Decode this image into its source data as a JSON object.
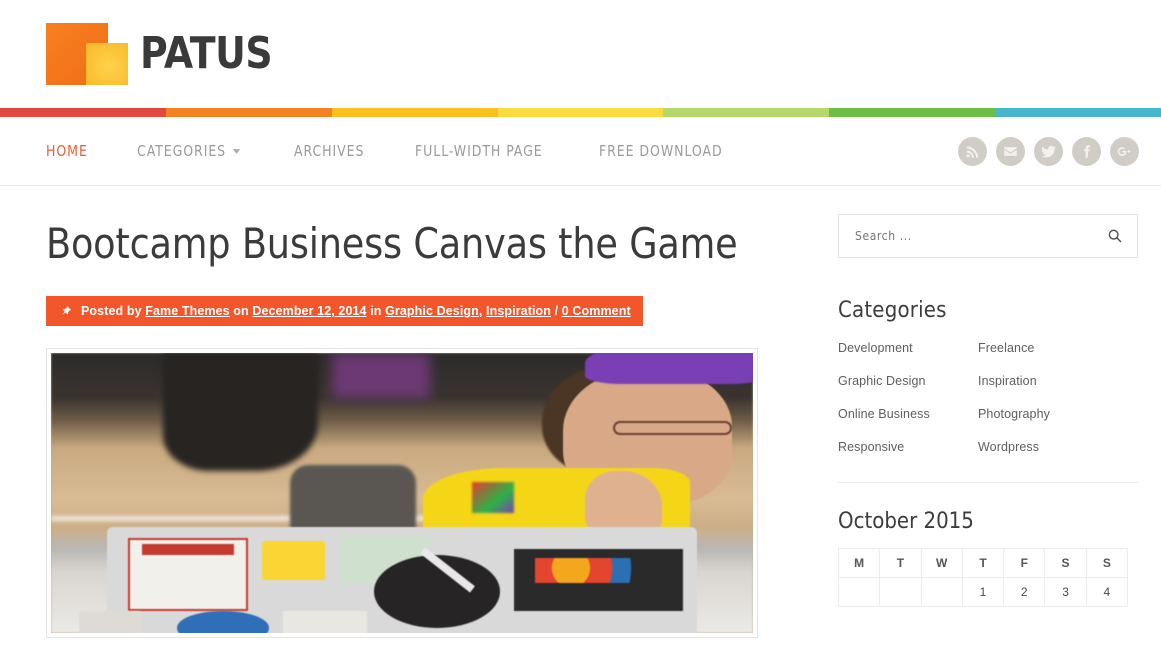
{
  "header": {
    "logo_text": "PATUS",
    "logo_colors": {
      "big_square": "#f4761a",
      "small_square": "#fcc63a"
    }
  },
  "rainbow": {
    "colors": [
      "#e0493c",
      "#f58220",
      "#f9c01f",
      "#fbdc3e",
      "#b5d86a",
      "#6cbe45",
      "#45b6cd"
    ]
  },
  "nav": {
    "items": [
      {
        "label": "HOME",
        "active": true,
        "has_dropdown": false
      },
      {
        "label": "CATEGORIES",
        "active": false,
        "has_dropdown": true
      },
      {
        "label": "ARCHIVES",
        "active": false,
        "has_dropdown": false
      },
      {
        "label": "FULL-WIDTH PAGE",
        "active": false,
        "has_dropdown": false
      },
      {
        "label": "FREE DOWNLOAD",
        "active": false,
        "has_dropdown": false
      }
    ],
    "active_color": "#ef5b35",
    "social": [
      {
        "name": "rss-icon"
      },
      {
        "name": "email-icon"
      },
      {
        "name": "twitter-icon"
      },
      {
        "name": "facebook-icon"
      },
      {
        "name": "google-plus-icon"
      }
    ]
  },
  "post": {
    "title": "Bootcamp Business Canvas the Game",
    "meta": {
      "bg_color": "#f2562a",
      "posted_by_label": "Posted by",
      "author": "Fame Themes",
      "on_label": "on",
      "date": "December 12, 2014",
      "in_label": "in",
      "category_1": "Graphic Design",
      "comma": ",",
      "category_2": "Inspiration",
      "slash": "/",
      "comments": "0 Comment"
    },
    "image_alt": "Person in purple hat and yellow shirt working at a sticker-covered laptop"
  },
  "sidebar": {
    "search": {
      "placeholder": "Search ...",
      "value": ""
    },
    "categories": {
      "title": "Categories",
      "items": [
        "Development",
        "Freelance",
        "Graphic Design",
        "Inspiration",
        "Online Business",
        "Photography",
        "Responsive",
        "Wordpress"
      ]
    },
    "calendar": {
      "title": "October 2015",
      "day_headers": [
        "M",
        "T",
        "W",
        "T",
        "F",
        "S",
        "S"
      ],
      "weeks": [
        [
          "",
          "",
          "",
          "1",
          "2",
          "3",
          "4"
        ]
      ]
    }
  }
}
